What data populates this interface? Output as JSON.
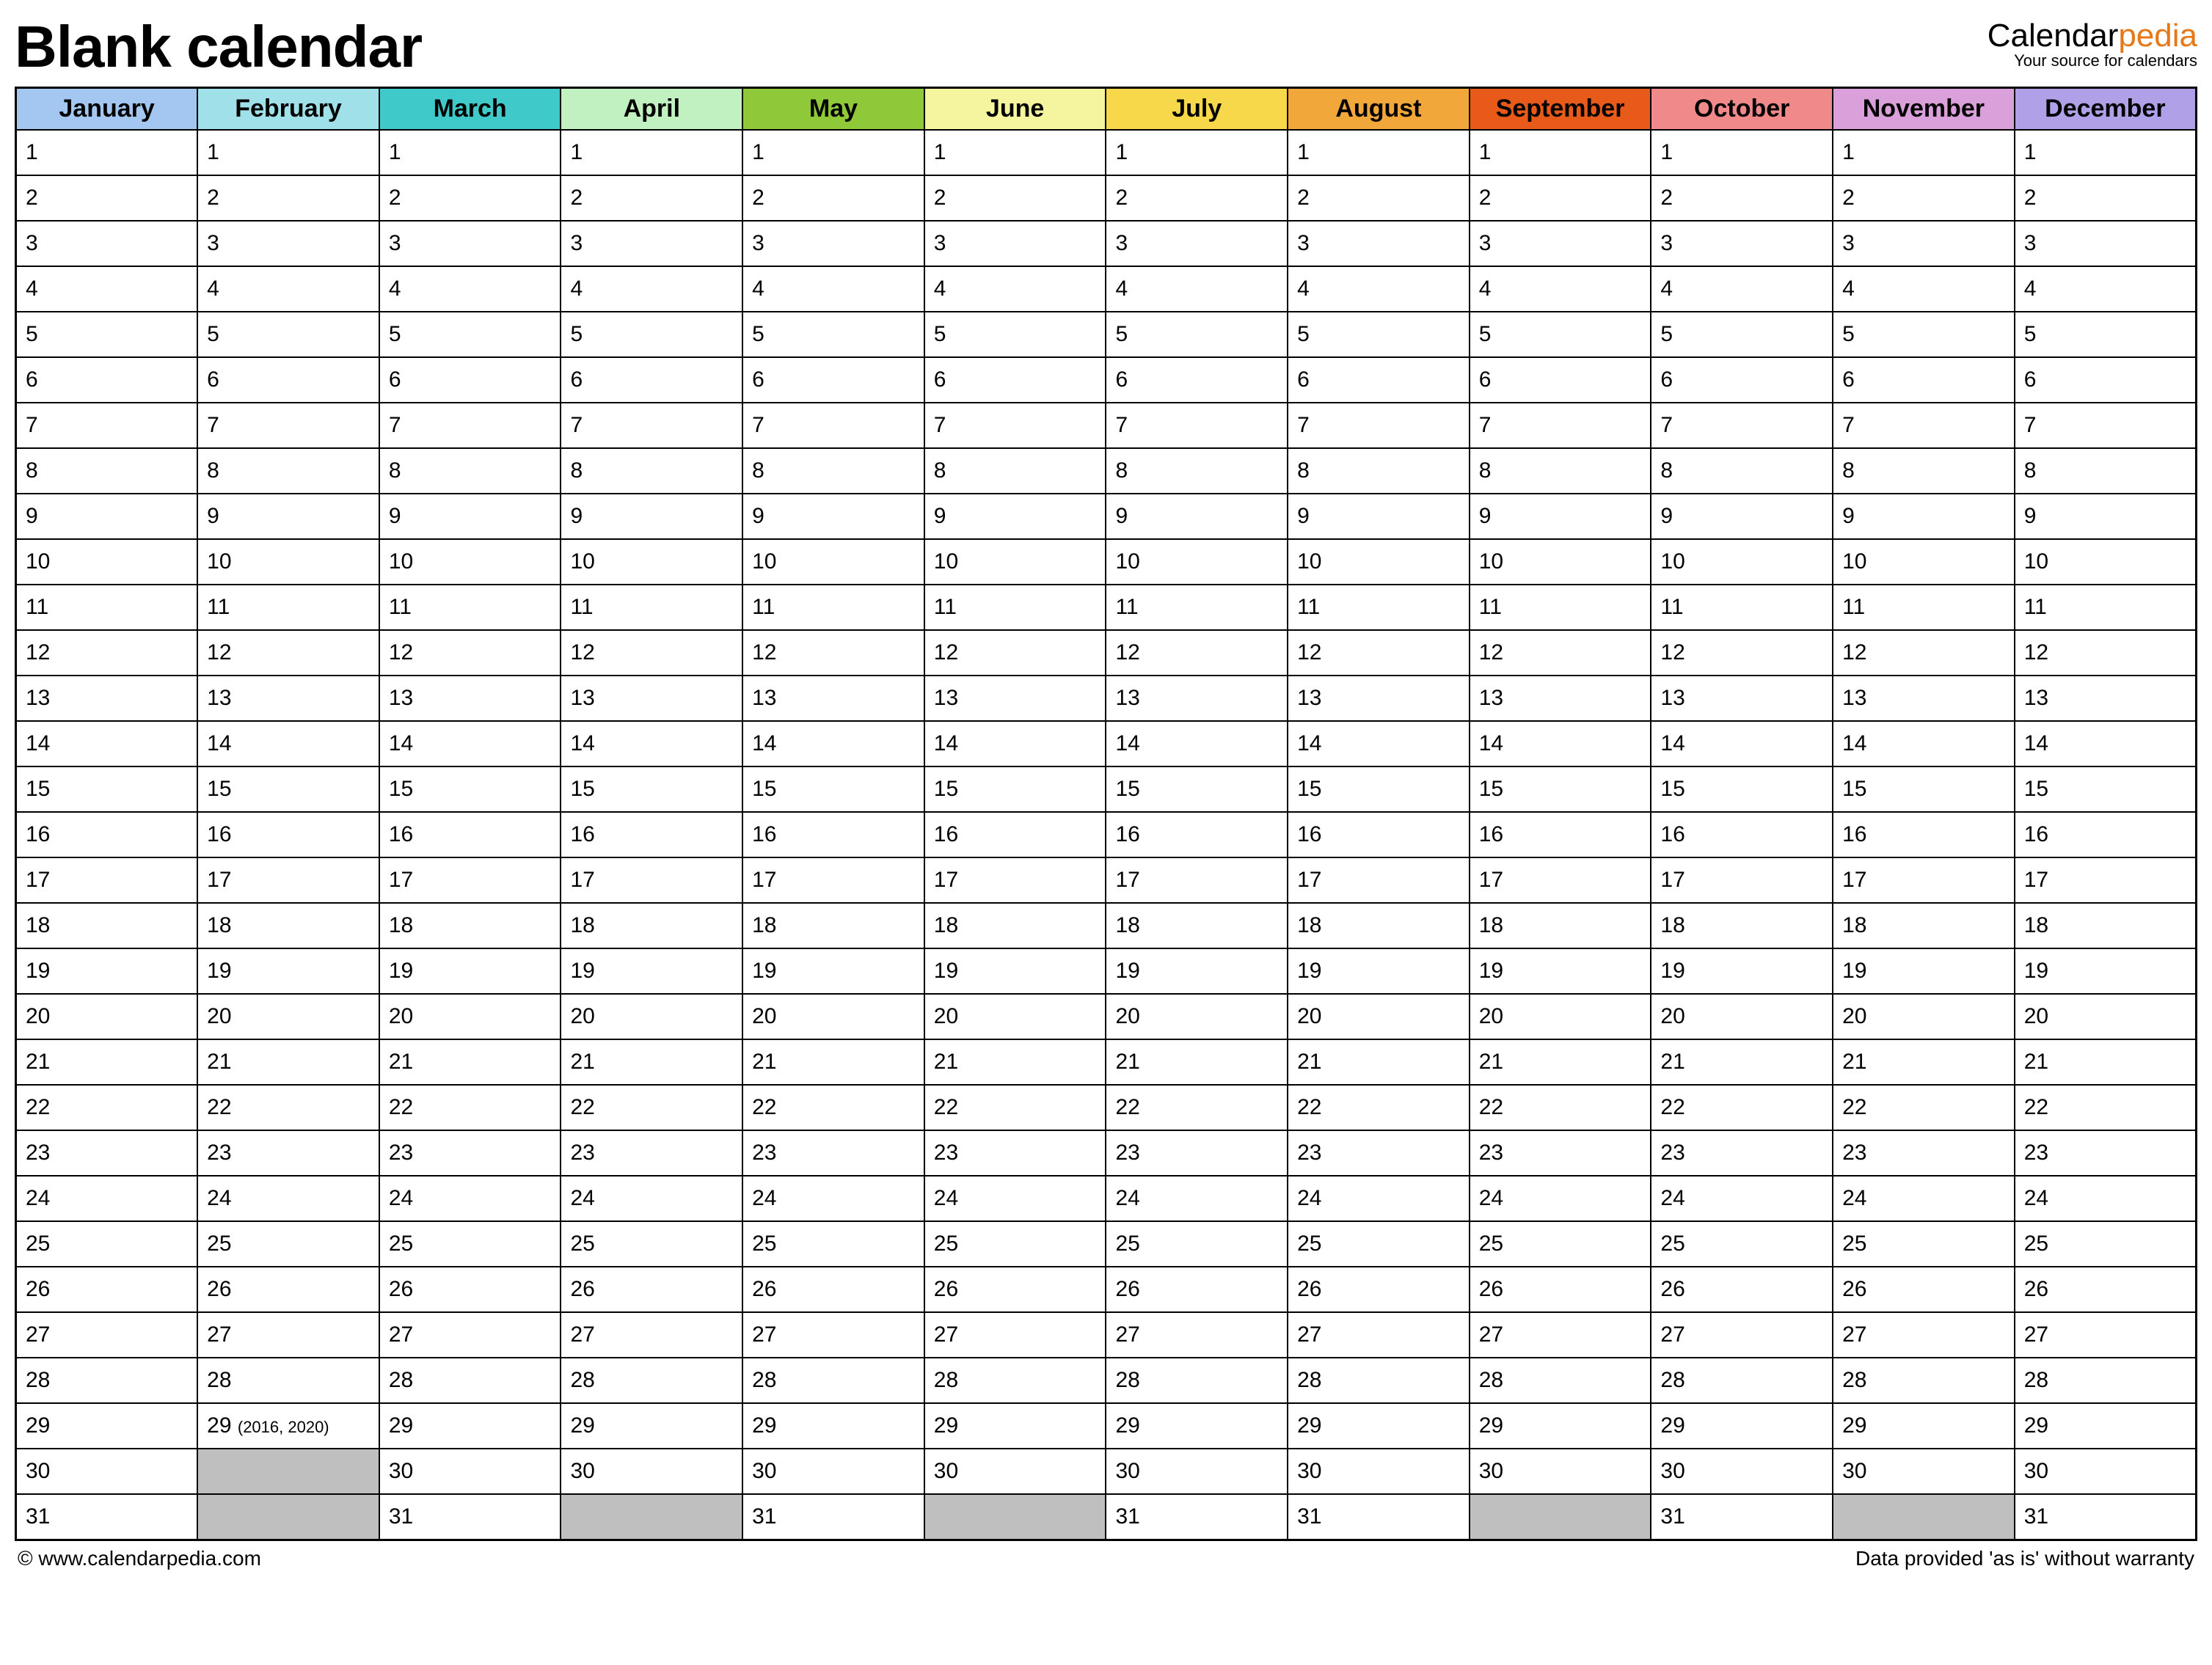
{
  "title": "Blank calendar",
  "brand": {
    "prefix": "Calendar",
    "accent": "pedia",
    "tagline": "Your source for calendars"
  },
  "months": [
    {
      "name": "January",
      "color": "#a3c7f0",
      "days": 31
    },
    {
      "name": "February",
      "color": "#a0e0e8",
      "days": 29,
      "leap_day": 29,
      "leap_note": "(2016, 2020)"
    },
    {
      "name": "March",
      "color": "#3fc9c9",
      "days": 31
    },
    {
      "name": "April",
      "color": "#c1f0c1",
      "days": 30
    },
    {
      "name": "May",
      "color": "#8fc93a",
      "days": 31
    },
    {
      "name": "June",
      "color": "#f5f5a0",
      "days": 30
    },
    {
      "name": "July",
      "color": "#f7d84a",
      "days": 31
    },
    {
      "name": "August",
      "color": "#f2a73a",
      "days": 31
    },
    {
      "name": "September",
      "color": "#e85a1a",
      "days": 30
    },
    {
      "name": "October",
      "color": "#f08a8a",
      "days": 31
    },
    {
      "name": "November",
      "color": "#d9a0d9",
      "days": 30
    },
    {
      "name": "December",
      "color": "#b0a0e8",
      "days": 31
    }
  ],
  "max_rows": 31,
  "footer": {
    "left": "© www.calendarpedia.com",
    "right": "Data provided 'as is' without warranty"
  }
}
